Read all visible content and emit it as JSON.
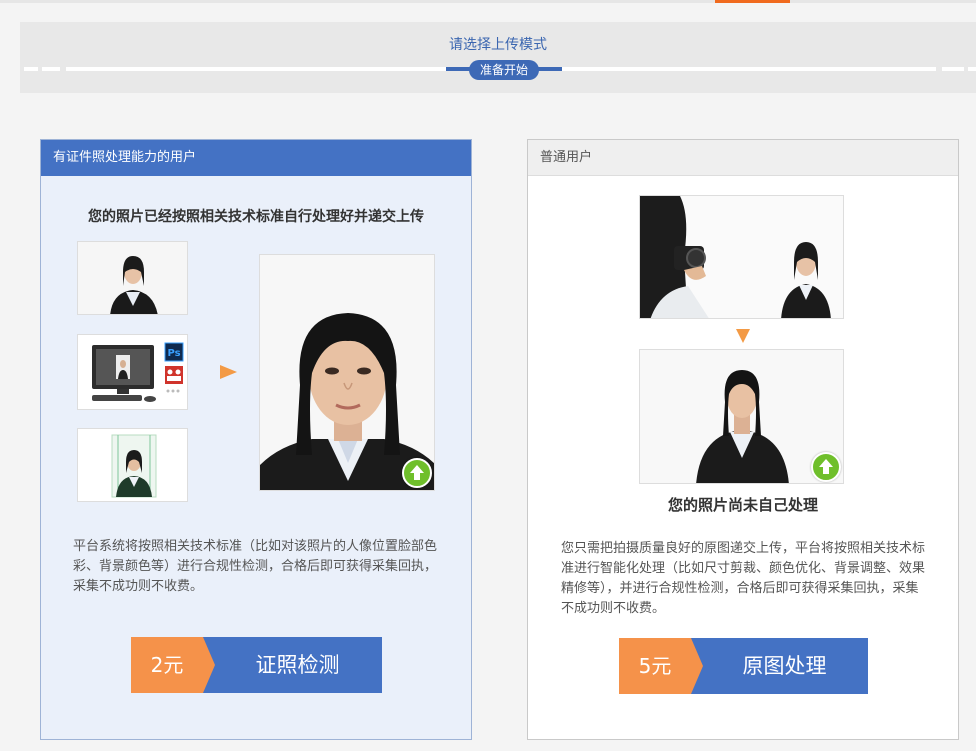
{
  "stepbar": {
    "title": "请选择上传模式",
    "pill": "准备开始"
  },
  "left_panel": {
    "header": "有证件照处理能力的用户",
    "headline": "您的照片已经按照相关技术标准自行处理好并递交上传",
    "description": "平台系统将按照相关技术标准（比如对该照片的人像位置脸部色彩、背景颜色等）进行合规性检测，合格后即可获得采集回执，采集不成功则不收费。",
    "software_icons": [
      "Ps"
    ],
    "price": "2元",
    "button_label": "证照检测"
  },
  "right_panel": {
    "header": "普通用户",
    "headline": "您的照片尚未自己处理",
    "description": "您只需把拍摄质量良好的原图递交上传，平台将按照相关技术标准进行智能化处理（比如尺寸剪裁、颜色优化、背景调整、效果精修等），并进行合规性检测，合格后即可获得采集回执，采集不成功则不收费。",
    "price": "5元",
    "button_label": "原图处理"
  },
  "colors": {
    "primary": "#4472c4",
    "accent_orange": "#f5924a",
    "upload_green": "#6fbf2b"
  }
}
